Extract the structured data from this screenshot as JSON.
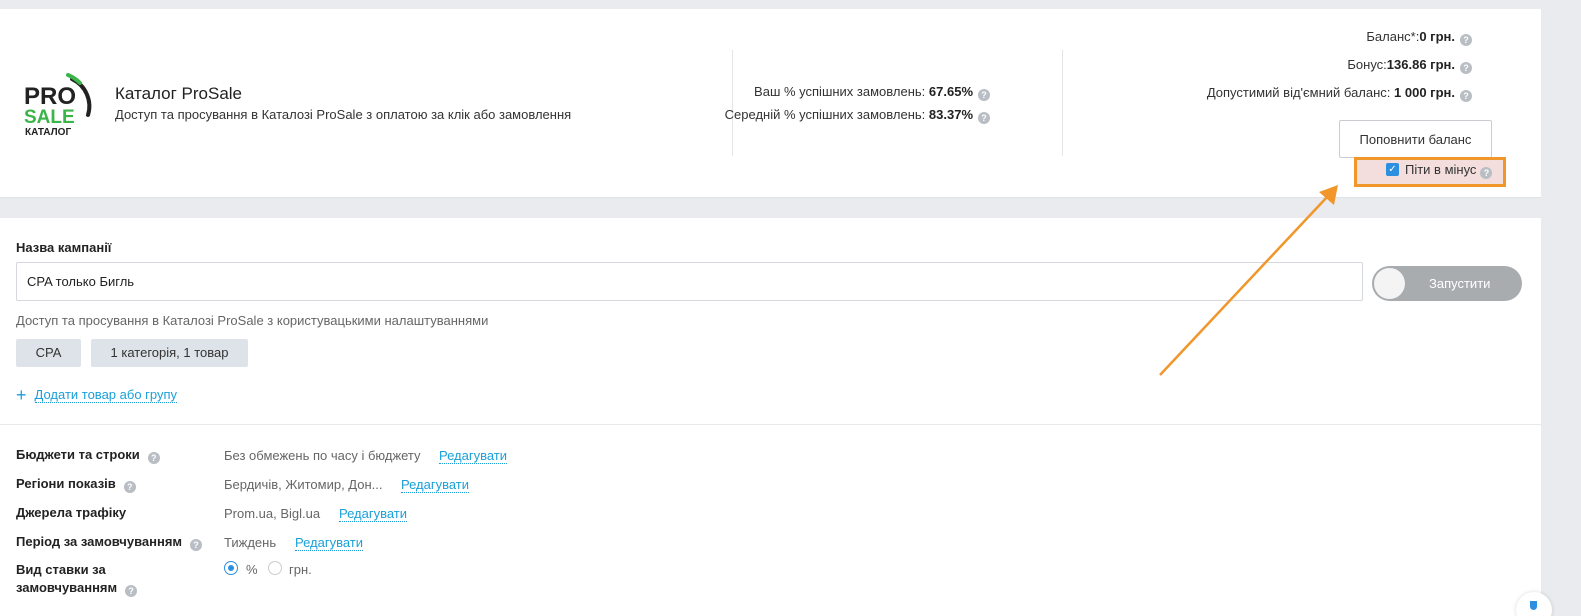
{
  "catalog": {
    "logo_text_top": "PRO",
    "logo_text_mid": "SALE",
    "logo_text_bottom": "КАТАЛОГ",
    "title": "Каталог ProSale",
    "description": "Доступ та просування в Каталозі ProSale з оплатою за клік або замовлення"
  },
  "stats": {
    "your_label": "Ваш % успішних замовлень:",
    "your_value": "67.65%",
    "avg_label": "Середній % успішних замовлень:",
    "avg_value": "83.37%"
  },
  "balance": {
    "balance_label": "Баланс*:",
    "balance_value": "0 грн.",
    "bonus_label": "Бонус:",
    "bonus_value": "136.86 грн.",
    "negative_label": "Допустимий від'ємний баланс:",
    "negative_value": "1 000 грн.",
    "topup_button": "Поповнити баланс",
    "go_negative_label": "Піти в мінус",
    "go_negative_checked": true
  },
  "campaign": {
    "name_label": "Назва кампанії",
    "name_value": "CPA только Бигль",
    "toggle_label": "Запустити",
    "description": "Доступ та просування в Каталозі ProSale з користувацькими налаштуваннями",
    "chips": [
      "CPA",
      "1 категорія, 1 товар"
    ],
    "add_link": "Додати товар або групу"
  },
  "settings": {
    "budget_label": "Бюджети та строки",
    "budget_value": "Без обмежень по часу і бюджету",
    "regions_label": "Регіони показів",
    "regions_value": "Бердичів, Житомир, Дон...",
    "traffic_label": "Джерела трафіку",
    "traffic_value": "Prom.ua, Bigl.ua",
    "period_label": "Період за замовчуванням",
    "period_value": "Тиждень",
    "rate_label_line1": "Вид ставки за",
    "rate_label_line2": "замовчуванням",
    "rate_options": [
      "%",
      "грн."
    ],
    "rate_selected": "%",
    "edit_link": "Редагувати"
  },
  "icons": {
    "help": "question-icon",
    "add": "plus-icon",
    "check": "checkmark-icon"
  },
  "colors": {
    "accent": "#1aa0d8",
    "brand_green": "#3bb54a",
    "highlight_border": "#f0962a",
    "highlight_fill": "#f3dedd",
    "checkbox": "#2d8fe0",
    "toggle_off": "#a9acaf"
  }
}
